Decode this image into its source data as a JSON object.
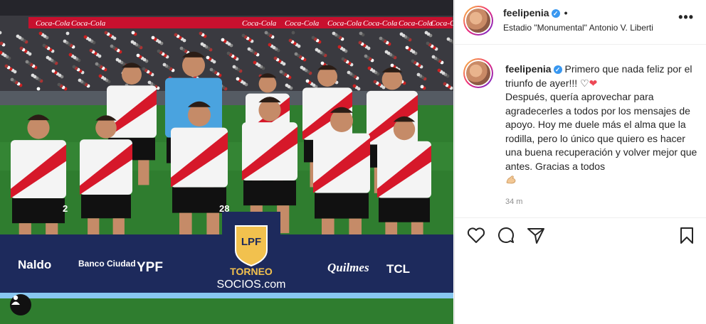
{
  "photo": {
    "ad_boards": [
      "Coca-Cola",
      "Coca-Cola",
      "Coca-Cola",
      "Coca-Cola",
      "Coca-Cola",
      "Coca-Cola",
      "Coca-Cola",
      "Coca-Cola"
    ],
    "sponsors": [
      "Naldo",
      "Banco Ciudad",
      "YPF",
      "Quilmes",
      "TCL"
    ],
    "league_badge": "LPF",
    "league_text_1": "TORNEO",
    "league_text_2": "SOCIOS.com",
    "jersey_numbers": [
      "2",
      "28"
    ]
  },
  "post": {
    "username": "feelipenia",
    "location": "Estadio \"Monumental\" Antonio V. Liberti",
    "caption_first": " Primero que nada feliz por el triunfo de ayer!!! ",
    "caption_rest": "Después, quería aprovechar para agradecerles a todos por los mensajes de apoyo. Hoy me duele más el alma que la rodilla, pero lo único que quiero es hacer una buena recuperación y volver mejor que antes. Gracias a todos",
    "time_ago": "34 m",
    "hearts_outline": "♡",
    "hearts_red": "❤"
  },
  "icons": {
    "like": "heart-icon",
    "comment": "comment-icon",
    "share": "share-icon",
    "save": "bookmark-icon",
    "more": "more-options-icon",
    "verified": "verified-badge-icon",
    "user_tag": "user-tag-icon"
  },
  "colors": {
    "verified": "#3897f0",
    "red_heart": "#ed4956",
    "muted": "#8e8e8e",
    "river_red": "#d6182a"
  }
}
